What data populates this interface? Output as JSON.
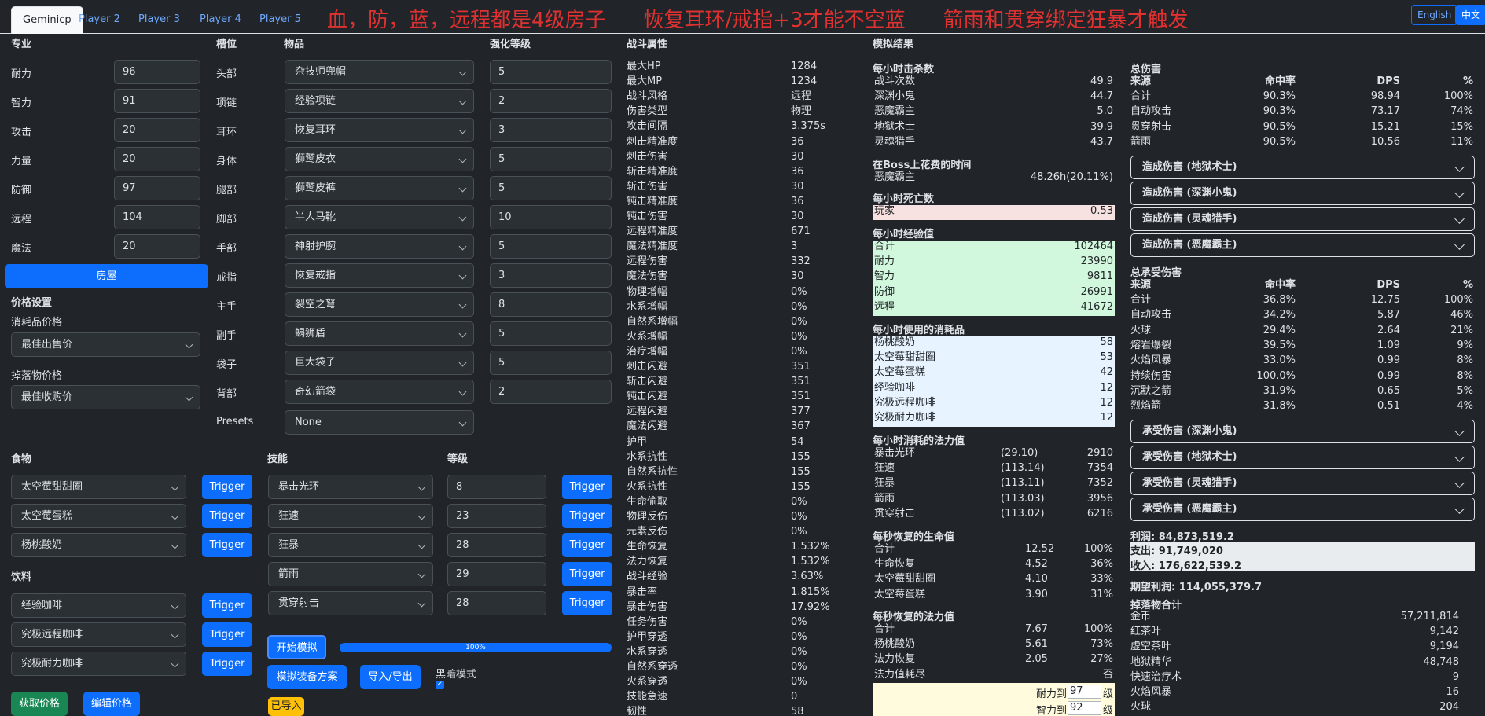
{
  "tabs": [
    "Geminicp",
    "Player 2",
    "Player 3",
    "Player 4",
    "Player 5"
  ],
  "notice": [
    "血，防，蓝，远程都是4级房子",
    "恢复耳环/戒指+3才能不空蓝",
    "箭雨和贯穿绑定狂暴才触发"
  ],
  "lang": {
    "en": "English",
    "zh": "中文"
  },
  "profession": {
    "header": "专业",
    "items": [
      {
        "label": "耐力",
        "value": "96"
      },
      {
        "label": "智力",
        "value": "91"
      },
      {
        "label": "攻击",
        "value": "20"
      },
      {
        "label": "力量",
        "value": "20"
      },
      {
        "label": "防御",
        "value": "97"
      },
      {
        "label": "远程",
        "value": "104"
      },
      {
        "label": "魔法",
        "value": "20"
      }
    ],
    "house_button": "房屋"
  },
  "price": {
    "header": "价格设置",
    "consumable_label": "消耗品价格",
    "consumable_value": "最佳出售价",
    "drop_label": "掉落物价格",
    "drop_value": "最佳收购价"
  },
  "equipment": {
    "h_slot": "槽位",
    "h_item": "物品",
    "h_level": "强化等级",
    "rows": [
      {
        "slot": "头部",
        "item": "杂技师兜帽",
        "level": "5"
      },
      {
        "slot": "项链",
        "item": "经验项链",
        "level": "2"
      },
      {
        "slot": "耳环",
        "item": "恢复耳环",
        "level": "3"
      },
      {
        "slot": "身体",
        "item": "獅鹫皮衣",
        "level": "5"
      },
      {
        "slot": "腿部",
        "item": "獅鹫皮裤",
        "level": "5"
      },
      {
        "slot": "脚部",
        "item": "半人马靴",
        "level": "10"
      },
      {
        "slot": "手部",
        "item": "神射护腕",
        "level": "5"
      },
      {
        "slot": "戒指",
        "item": "恢复戒指",
        "level": "3"
      },
      {
        "slot": "主手",
        "item": "裂空之弩",
        "level": "8"
      },
      {
        "slot": "副手",
        "item": "蝎狮盾",
        "level": "5"
      },
      {
        "slot": "袋子",
        "item": "巨大袋子",
        "level": "5"
      },
      {
        "slot": "背部",
        "item": "奇幻箭袋",
        "level": "2"
      }
    ],
    "presets_label": "Presets",
    "presets_value": "None"
  },
  "food": {
    "header": "食物",
    "items": [
      "太空莓甜甜圈",
      "太空莓蛋糕",
      "杨桃酸奶"
    ],
    "trigger": "Trigger"
  },
  "drink": {
    "header": "饮料",
    "items": [
      "经验咖啡",
      "究极远程咖啡",
      "究极耐力咖啡"
    ]
  },
  "skills": {
    "h_skill": "技能",
    "h_level": "等级",
    "rows": [
      {
        "name": "暴击光环",
        "level": "8"
      },
      {
        "name": "狂速",
        "level": "23"
      },
      {
        "name": "狂暴",
        "level": "28"
      },
      {
        "name": "箭雨",
        "level": "29"
      },
      {
        "name": "贯穿射击",
        "level": "28"
      }
    ]
  },
  "controls": {
    "start": "开始模拟",
    "progress": "100%",
    "progress_value": 1.0,
    "sim_equip": "模拟装备方案",
    "import_export": "导入/导出",
    "dark_mode": "黑暗模式",
    "imported": "已导入",
    "get_price": "获取价格",
    "edit_price": "编辑价格"
  },
  "combat": {
    "header": "战斗属性",
    "rows": [
      [
        "最大HP",
        "1284"
      ],
      [
        "最大MP",
        "1234"
      ],
      [
        "战斗风格",
        "远程"
      ],
      [
        "伤害类型",
        "物理"
      ],
      [
        "攻击间隔",
        "3.375s"
      ],
      [
        "刺击精准度",
        "36"
      ],
      [
        "刺击伤害",
        "30"
      ],
      [
        "斩击精准度",
        "36"
      ],
      [
        "斩击伤害",
        "30"
      ],
      [
        "钝击精准度",
        "36"
      ],
      [
        "钝击伤害",
        "30"
      ],
      [
        "远程精准度",
        "671"
      ],
      [
        "魔法精准度",
        "3"
      ],
      [
        "远程伤害",
        "332"
      ],
      [
        "魔法伤害",
        "30"
      ],
      [
        "物理增幅",
        "0%"
      ],
      [
        "水系增幅",
        "0%"
      ],
      [
        "自然系增幅",
        "0%"
      ],
      [
        "火系增幅",
        "0%"
      ],
      [
        "治疗增幅",
        "0%"
      ],
      [
        "刺击闪避",
        "351"
      ],
      [
        "斩击闪避",
        "351"
      ],
      [
        "钝击闪避",
        "351"
      ],
      [
        "远程闪避",
        "377"
      ],
      [
        "魔法闪避",
        "367"
      ],
      [
        "护甲",
        "54"
      ],
      [
        "水系抗性",
        "155"
      ],
      [
        "自然系抗性",
        "155"
      ],
      [
        "火系抗性",
        "155"
      ],
      [
        "生命偷取",
        "0%"
      ],
      [
        "物理反伤",
        "0%"
      ],
      [
        "元素反伤",
        "0%"
      ],
      [
        "生命恢复",
        "1.532%"
      ],
      [
        "法力恢复",
        "1.532%"
      ],
      [
        "战斗经验",
        "3.63%"
      ],
      [
        "暴击率",
        "1.815%"
      ],
      [
        "暴击伤害",
        "17.92%"
      ],
      [
        "任务伤害",
        "0%"
      ],
      [
        "护甲穿透",
        "0%"
      ],
      [
        "水系穿透",
        "0%"
      ],
      [
        "自然系穿透",
        "0%"
      ],
      [
        "火系穿透",
        "0%"
      ],
      [
        "技能急速",
        "0"
      ],
      [
        "韧性",
        "58"
      ]
    ]
  },
  "sim": {
    "header": "模拟结果",
    "kills": {
      "title": "每小时击杀数",
      "rows": [
        [
          "战斗次数",
          "49.9"
        ],
        [
          "深渊小鬼",
          "44.7"
        ],
        [
          "恶魔霸主",
          "5.0"
        ],
        [
          "地狱术士",
          "39.9"
        ],
        [
          "灵魂猎手",
          "43.7"
        ]
      ]
    },
    "boss": {
      "title": "在Boss上花费的时间",
      "rows": [
        [
          "恶魔霸主",
          "48.26h(20.11%)"
        ]
      ]
    },
    "deaths": {
      "title": "每小时死亡数",
      "rows": [
        [
          "玩家",
          "0.53"
        ]
      ]
    },
    "exp": {
      "title": "每小时经验值",
      "rows": [
        [
          "合计",
          "102464"
        ],
        [
          "耐力",
          "23990"
        ],
        [
          "智力",
          "9811"
        ],
        [
          "防御",
          "26991"
        ],
        [
          "远程",
          "41672"
        ]
      ]
    },
    "consumables": {
      "title": "每小时使用的消耗品",
      "rows": [
        [
          "杨桃酸奶",
          "58"
        ],
        [
          "太空莓甜甜圈",
          "53"
        ],
        [
          "太空莓蛋糕",
          "42"
        ],
        [
          "经验咖啡",
          "12"
        ],
        [
          "究极远程咖啡",
          "12"
        ],
        [
          "究极耐力咖啡",
          "12"
        ]
      ]
    },
    "mana": {
      "title": "每小时消耗的法力值",
      "rows": [
        [
          "暴击光环",
          "(29.10)",
          "2910"
        ],
        [
          "狂速",
          "(113.14)",
          "7354"
        ],
        [
          "狂暴",
          "(113.11)",
          "7352"
        ],
        [
          "箭雨",
          "(113.03)",
          "3956"
        ],
        [
          "贯穿射击",
          "(113.02)",
          "6216"
        ]
      ]
    },
    "hpregen": {
      "title": "每秒恢复的生命值",
      "rows": [
        [
          "合计",
          "12.52",
          "100%"
        ],
        [
          "生命恢复",
          "4.52",
          "36%"
        ],
        [
          "太空莓甜甜圈",
          "4.10",
          "33%"
        ],
        [
          "太空莓蛋糕",
          "3.90",
          "31%"
        ]
      ]
    },
    "mpregen": {
      "title": "每秒恢复的法力值",
      "rows": [
        [
          "合计",
          "7.67",
          "100%"
        ],
        [
          "杨桃酸奶",
          "5.61",
          "73%"
        ],
        [
          "法力恢复",
          "2.05",
          "27%"
        ]
      ]
    },
    "mana_out": {
      "label": "法力值耗尽",
      "value": "否"
    },
    "level_inputs": [
      {
        "label": "耐力到",
        "value": "97",
        "suffix": "级"
      },
      {
        "label": "智力到",
        "value": "92",
        "suffix": "级"
      }
    ]
  },
  "damage": {
    "title": "总伤害",
    "cols": [
      "来源",
      "命中率",
      "DPS",
      "%"
    ],
    "rows": [
      [
        "合计",
        "90.3%",
        "98.94",
        "100%"
      ],
      [
        "自动攻击",
        "90.3%",
        "73.17",
        "74%"
      ],
      [
        "贯穿射击",
        "90.5%",
        "15.21",
        "15%"
      ],
      [
        "箭雨",
        "90.5%",
        "10.56",
        "11%"
      ]
    ],
    "dealt": [
      "造成伤害 (地狱术士)",
      "造成伤害 (深渊小鬼)",
      "造成伤害 (灵魂猎手)",
      "造成伤害 (恶魔霸主)"
    ]
  },
  "taken": {
    "title": "总承受伤害",
    "cols": [
      "来源",
      "命中率",
      "DPS",
      "%"
    ],
    "rows": [
      [
        "合计",
        "36.8%",
        "12.75",
        "100%"
      ],
      [
        "自动攻击",
        "34.2%",
        "5.87",
        "46%"
      ],
      [
        "火球",
        "29.4%",
        "2.64",
        "21%"
      ],
      [
        "熔岩爆裂",
        "39.5%",
        "1.09",
        "9%"
      ],
      [
        "火焰风暴",
        "33.0%",
        "0.99",
        "8%"
      ],
      [
        "持续伤害",
        "100.0%",
        "0.99",
        "8%"
      ],
      [
        "沉默之箭",
        "31.9%",
        "0.65",
        "5%"
      ],
      [
        "烈焰箭",
        "31.8%",
        "0.51",
        "4%"
      ]
    ],
    "items": [
      "承受伤害 (深渊小鬼)",
      "承受伤害 (地狱术士)",
      "承受伤害 (灵魂猎手)",
      "承受伤害 (恶魔霸主)"
    ]
  },
  "profit": {
    "profit": "利润: 84,873,519.2",
    "expense": "支出: 91,749,020",
    "income": "收入: 176,622,539.2",
    "expected": "期望利润: 114,055,379.7"
  },
  "drops": {
    "title": "掉落物合计",
    "rows": [
      [
        "金币",
        "57,211,814"
      ],
      [
        "红茶叶",
        "9,142"
      ],
      [
        "虚空茶叶",
        "9,194"
      ],
      [
        "地狱精华",
        "48,748"
      ],
      [
        "快速治疗术",
        "9"
      ],
      [
        "火焰风暴",
        "16"
      ],
      [
        "火球",
        "204"
      ]
    ]
  }
}
